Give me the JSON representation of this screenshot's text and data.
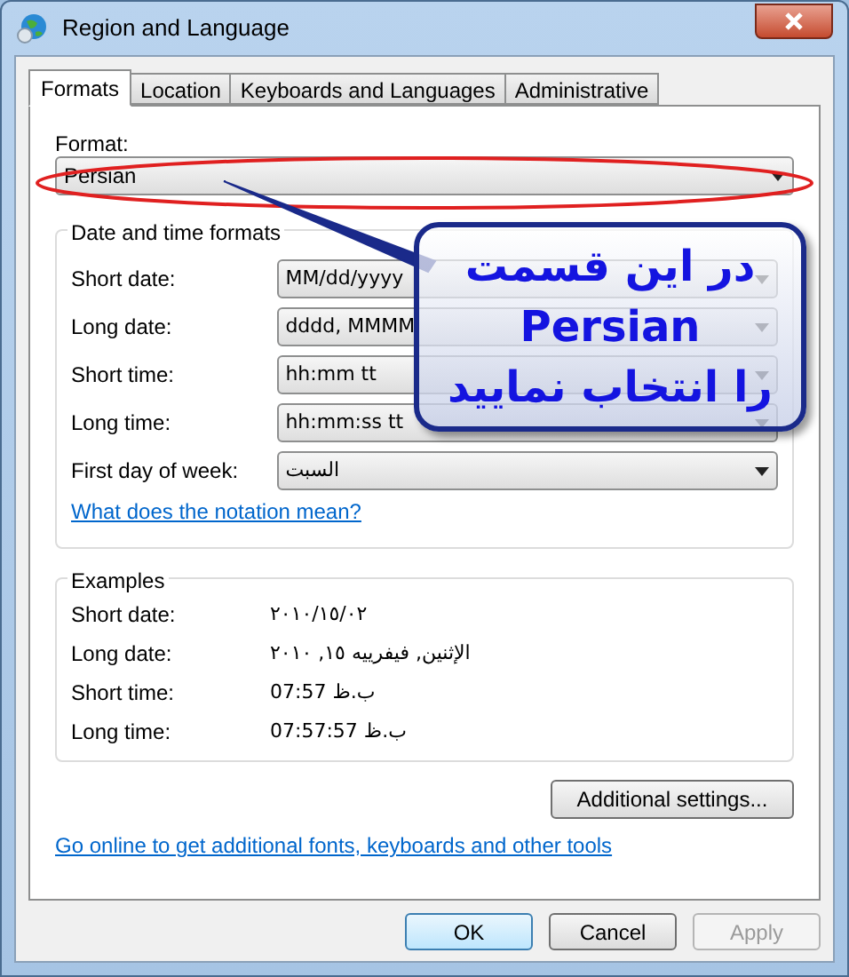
{
  "window": {
    "title": "Region and Language"
  },
  "tabs": [
    {
      "label": "Formats",
      "selected": true
    },
    {
      "label": "Location",
      "selected": false
    },
    {
      "label": "Keyboards and Languages",
      "selected": false
    },
    {
      "label": "Administrative",
      "selected": false
    }
  ],
  "format": {
    "label": "Format:",
    "value": "Persian"
  },
  "date_time_formats": {
    "title": "Date and time formats",
    "rows": [
      {
        "label": "Short date:",
        "value": "MM/dd/yyyy"
      },
      {
        "label": "Long date:",
        "value": "dddd, MMMM"
      },
      {
        "label": "Short time:",
        "value": "hh:mm tt"
      },
      {
        "label": "Long time:",
        "value": "hh:mm:ss tt"
      },
      {
        "label": "First day of week:",
        "value": "السبت"
      }
    ]
  },
  "notation_link": "What does the notation mean?",
  "examples": {
    "title": "Examples",
    "rows": [
      {
        "label": "Short date:",
        "value": "٢٠١٠/١٥/٠٢"
      },
      {
        "label": "Long date:",
        "value": "الإثنين, فيفرييه ١٥, ٢٠١٠"
      },
      {
        "label": "Short time:",
        "value": "07:57 ب.ظ"
      },
      {
        "label": "Long time:",
        "value": "07:57:57 ب.ظ"
      }
    ]
  },
  "additional_settings_button": "Additional settings...",
  "online_link": "Go online to get additional fonts, keyboards and other tools",
  "buttons": [
    {
      "label": "OK",
      "disabled": false,
      "default": true
    },
    {
      "label": "Cancel",
      "disabled": false,
      "default": false
    },
    {
      "label": "Apply",
      "disabled": true,
      "default": false
    }
  ],
  "callout": {
    "lines": [
      "در این قسمت",
      "Persian",
      "را انتخاب نمایید"
    ]
  }
}
